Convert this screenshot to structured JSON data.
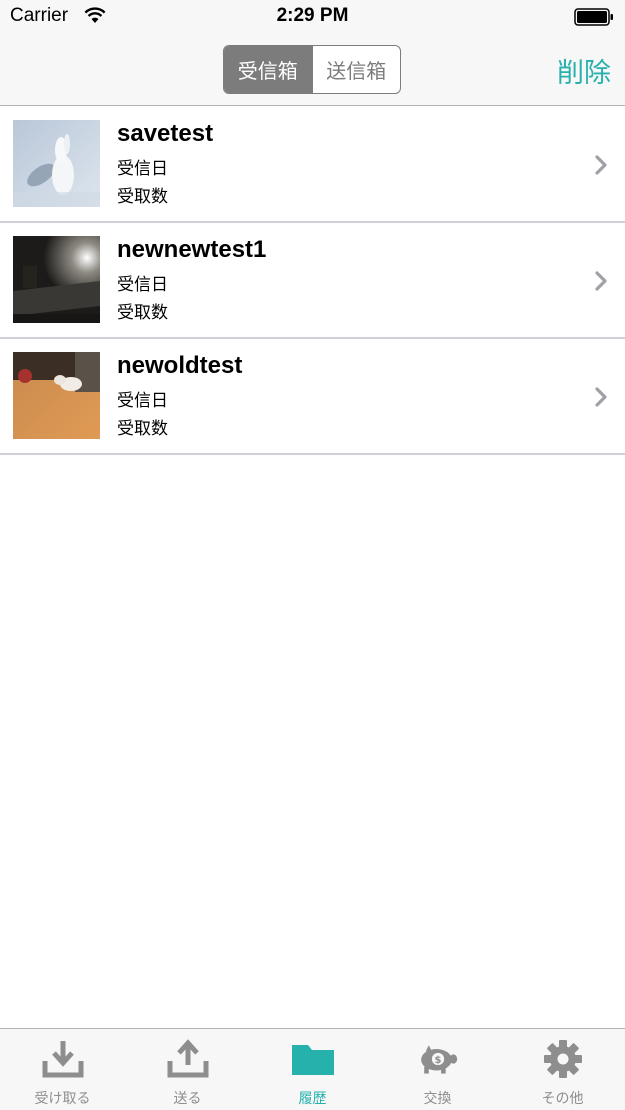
{
  "status_bar": {
    "carrier": "Carrier",
    "time": "2:29 PM"
  },
  "nav": {
    "segments": [
      "受信箱",
      "送信箱"
    ],
    "selected_segment": "受信箱",
    "delete_label": "削除"
  },
  "list": {
    "items": [
      {
        "title": "savetest",
        "line1": "受信日",
        "line2": "受取数",
        "thumbnail": "snow-rabbit-photo"
      },
      {
        "title": "newnewtest1",
        "line1": "受信日",
        "line2": "受取数",
        "thumbnail": "dark-room-photo"
      },
      {
        "title": "newoldtest",
        "line1": "受信日",
        "line2": "受取数",
        "thumbnail": "cat-on-floor-photo"
      }
    ]
  },
  "tabs": [
    {
      "label": "受け取る",
      "icon": "download-icon",
      "active": false
    },
    {
      "label": "送る",
      "icon": "upload-icon",
      "active": false
    },
    {
      "label": "履歴",
      "icon": "folder-icon",
      "active": true
    },
    {
      "label": "交換",
      "icon": "piggy-bank-icon",
      "active": false
    },
    {
      "label": "その他",
      "icon": "gear-icon",
      "active": false
    }
  ],
  "colors": {
    "accent": "#27b1ad",
    "inactive": "#8e8e8e",
    "segment": "#7c7c7c"
  }
}
